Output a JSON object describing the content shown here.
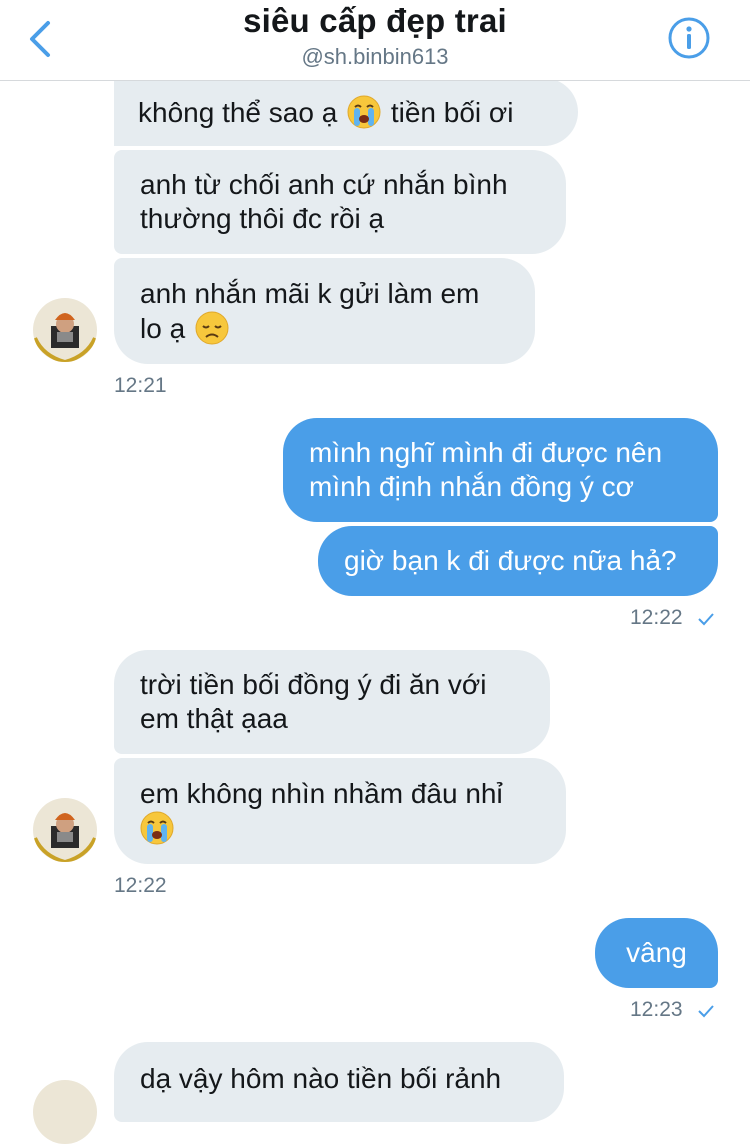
{
  "header": {
    "title": "siêu cấp đẹp trai",
    "handle": "@sh.binbin613"
  },
  "colors": {
    "accent": "#4a9ee8",
    "incoming_bubble": "#e6ecf0",
    "outgoing_bubble": "#4a9ee8",
    "timestamp": "#657786"
  },
  "messages": [
    {
      "from": "them",
      "part1": "không thể sao ạ",
      "emoji": "loudly-crying-face",
      "part2": "tiền bối ơi"
    },
    {
      "from": "them",
      "line1": "anh từ chối anh cứ nhắn bình",
      "line2": "thường thôi đc rồi ạ"
    },
    {
      "from": "them",
      "line1": "anh nhắn mãi k gửi làm em",
      "line2": "lo ạ",
      "emoji": "disappointed-face"
    },
    {
      "from": "me",
      "line1": "mình nghĩ mình đi được nên",
      "line2": "mình định nhắn đồng ý cơ"
    },
    {
      "from": "me",
      "text": "giờ bạn k đi được nữa hả?"
    },
    {
      "from": "them",
      "line1": "trời tiền bối đồng ý đi ăn với",
      "line2": "em thật ạaa"
    },
    {
      "from": "them",
      "line1": "em không nhìn nhầm đâu nhỉ",
      "emoji": "loudly-crying-face"
    },
    {
      "from": "me",
      "text": "vâng"
    },
    {
      "from": "them",
      "text": "dạ vậy hôm nào tiền bối rảnh"
    }
  ],
  "timestamps": {
    "t1": "12:21",
    "t2": "12:22",
    "t3": "12:22",
    "t4": "12:23"
  },
  "icons": {
    "back": "chevron-left-icon",
    "info": "info-icon",
    "read": "checkmark-icon"
  }
}
